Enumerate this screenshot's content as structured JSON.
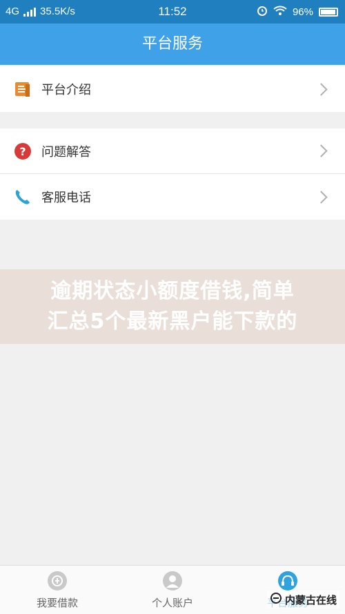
{
  "status_bar": {
    "network": "4G",
    "speed": "35.5K/s",
    "time": "11:52",
    "battery": "96%"
  },
  "header": {
    "title": "平台服务"
  },
  "menu_group_1": [
    {
      "label": "平台介绍",
      "icon": "document-icon"
    }
  ],
  "menu_group_2": [
    {
      "label": "问题解答",
      "icon": "question-icon"
    },
    {
      "label": "客服电话",
      "icon": "phone-icon"
    }
  ],
  "watermark": {
    "line1": "逾期状态小额度借钱,简单",
    "line2": "汇总5个最新黑户能下款的"
  },
  "tabbar": {
    "tabs": [
      {
        "label": "我要借款",
        "icon": "loan-icon"
      },
      {
        "label": "个人账户",
        "icon": "user-icon"
      },
      {
        "label": "平台服务",
        "icon": "headset-icon",
        "active": true
      }
    ]
  },
  "brand": {
    "text": "内蒙古在线"
  },
  "colors": {
    "status_bar": "#1f7fbf",
    "header": "#3fa1e8",
    "document_icon": "#e98a2e",
    "question_icon": "#d83a3a",
    "phone_icon": "#2aa3d4",
    "active_tab": "#2ea3e0"
  }
}
